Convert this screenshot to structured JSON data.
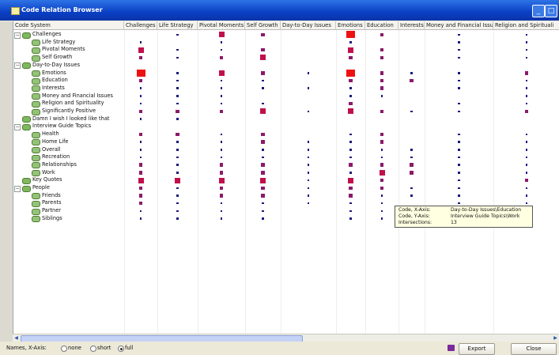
{
  "window": {
    "title": "Code Relation Browser",
    "buttons": {
      "minimize": "_",
      "maximize": "□"
    }
  },
  "columns": [
    "Code System",
    "Challenges",
    "Life Strategy",
    "Pivotal Moments",
    "Self Growth",
    "Day-to-Day Issues",
    "Emotions",
    "Education",
    "Interests",
    "Money and Financial Issues",
    "Religion and Spirituali"
  ],
  "rows": [
    {
      "label": "Challenges",
      "level": 0,
      "expander": "−",
      "icon": "code-group-icon"
    },
    {
      "label": "Life Strategy",
      "level": 1,
      "icon": "code-icon"
    },
    {
      "label": "Pivotal Moments",
      "level": 1,
      "icon": "code-icon"
    },
    {
      "label": "Self Growth",
      "level": 1,
      "icon": "code-icon"
    },
    {
      "label": "Day-to-Day Issues",
      "level": 0,
      "expander": "−",
      "icon": "code-group-icon"
    },
    {
      "label": "Emotions",
      "level": 1,
      "icon": "code-icon"
    },
    {
      "label": "Education",
      "level": 1,
      "icon": "code-icon"
    },
    {
      "label": "Interests",
      "level": 1,
      "icon": "code-icon"
    },
    {
      "label": "Money and Financial Issues",
      "level": 1,
      "icon": "code-icon"
    },
    {
      "label": "Religion and Spirituality",
      "level": 1,
      "icon": "code-icon"
    },
    {
      "label": "Significantly Positive",
      "level": 1,
      "icon": "code-icon"
    },
    {
      "label": "Damn I wish I looked like that",
      "level": 0,
      "icon": "code-group-icon"
    },
    {
      "label": "Interview Guide Topics",
      "level": 0,
      "expander": "−",
      "icon": "code-group-icon"
    },
    {
      "label": "Health",
      "level": 1,
      "icon": "code-icon"
    },
    {
      "label": "Home Life",
      "level": 1,
      "icon": "code-icon"
    },
    {
      "label": "Overall",
      "level": 1,
      "icon": "code-icon"
    },
    {
      "label": "Recreation",
      "level": 1,
      "icon": "code-icon"
    },
    {
      "label": "Relationships",
      "level": 1,
      "icon": "code-icon"
    },
    {
      "label": "Work",
      "level": 1,
      "icon": "code-icon"
    },
    {
      "label": "Key Quotes",
      "level": 0,
      "icon": "code-group-icon"
    },
    {
      "label": "People",
      "level": 0,
      "expander": "−",
      "icon": "code-group-icon"
    },
    {
      "label": "Friends",
      "level": 1,
      "icon": "code-icon"
    },
    {
      "label": "Parents",
      "level": 1,
      "icon": "code-icon"
    },
    {
      "label": "Partner",
      "level": 1,
      "icon": "code-icon"
    },
    {
      "label": "Siblings",
      "level": 1,
      "icon": "code-icon"
    }
  ],
  "matrix_note": "Each cell: 0 = empty, 1 = small dot, 2 = medium square, 3 = large square, 4 = largest red square",
  "matrix": [
    [
      0,
      1,
      3,
      2,
      0,
      4,
      2,
      0,
      1,
      1
    ],
    [
      1,
      0,
      1,
      0,
      0,
      1,
      0,
      0,
      1,
      1
    ],
    [
      3,
      1,
      1,
      2,
      0,
      3,
      2,
      0,
      1,
      1
    ],
    [
      2,
      1,
      2,
      3,
      0,
      2,
      2,
      0,
      1,
      1
    ],
    [
      0,
      0,
      0,
      0,
      0,
      0,
      0,
      0,
      0,
      0
    ],
    [
      4,
      1,
      3,
      2,
      1,
      4,
      2,
      1,
      1,
      2
    ],
    [
      2,
      1,
      1,
      1,
      0,
      2,
      2,
      2,
      1,
      1
    ],
    [
      1,
      1,
      1,
      1,
      1,
      1,
      2,
      0,
      1,
      1
    ],
    [
      1,
      1,
      1,
      0,
      0,
      1,
      1,
      0,
      0,
      1
    ],
    [
      1,
      1,
      1,
      1,
      0,
      2,
      0,
      0,
      1,
      1
    ],
    [
      2,
      2,
      2,
      3,
      1,
      3,
      2,
      1,
      1,
      2
    ],
    [
      1,
      1,
      0,
      0,
      0,
      0,
      0,
      0,
      0,
      0
    ],
    [
      0,
      0,
      0,
      0,
      0,
      0,
      0,
      0,
      0,
      0
    ],
    [
      2,
      2,
      1,
      2,
      0,
      1,
      2,
      0,
      1,
      1
    ],
    [
      1,
      1,
      1,
      2,
      1,
      1,
      2,
      0,
      1,
      1
    ],
    [
      1,
      1,
      1,
      1,
      1,
      1,
      1,
      1,
      1,
      1
    ],
    [
      1,
      1,
      1,
      1,
      1,
      1,
      1,
      1,
      1,
      1
    ],
    [
      2,
      1,
      2,
      2,
      1,
      2,
      2,
      2,
      1,
      1
    ],
    [
      2,
      1,
      2,
      2,
      1,
      1,
      3,
      2,
      1,
      1
    ],
    [
      3,
      3,
      3,
      3,
      1,
      3,
      2,
      0,
      1,
      2
    ],
    [
      2,
      1,
      2,
      2,
      1,
      2,
      2,
      1,
      1,
      1
    ],
    [
      2,
      1,
      2,
      2,
      1,
      2,
      1,
      1,
      1,
      1
    ],
    [
      2,
      1,
      1,
      1,
      1,
      1,
      1,
      0,
      1,
      1
    ],
    [
      1,
      1,
      1,
      1,
      0,
      1,
      1,
      0,
      1,
      1
    ],
    [
      1,
      1,
      1,
      1,
      0,
      1,
      1,
      0,
      1,
      1
    ]
  ],
  "colors": {
    "dot": "#1a1a80",
    "medium": "#8b1a6a",
    "large": "#c0104a",
    "largest": "#ee1111"
  },
  "tooltip": {
    "x_key": "Code, X-Axis:",
    "x_val": "Day-to-Day Issues\\Education",
    "y_key": "Code, Y-Axis:",
    "y_val": "Interview Guide Topics\\Work",
    "i_key": "Intersections:",
    "i_val": "13"
  },
  "status": {
    "names_label": "Names, X-Axis:",
    "opt_none": "none",
    "opt_short": "short",
    "opt_full": "full",
    "selected": "full",
    "export_label": "Export",
    "close_label": "Close"
  }
}
